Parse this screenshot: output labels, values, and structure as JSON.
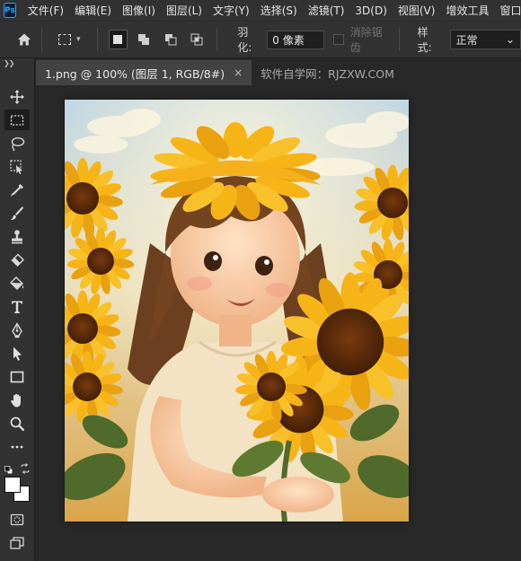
{
  "app": {
    "logo_text": "Ps"
  },
  "menu": [
    "文件(F)",
    "编辑(E)",
    "图像(I)",
    "图层(L)",
    "文字(Y)",
    "选择(S)",
    "滤镜(T)",
    "3D(D)",
    "视图(V)",
    "增效工具",
    "窗口(W)"
  ],
  "options": {
    "feather_label": "羽化:",
    "feather_value": "0 像素",
    "antialias_label": "消除锯齿",
    "style_label": "样式:",
    "style_value": "正常"
  },
  "tabs": [
    {
      "label": "1.png @ 100% (图层 1, RGB/8#)",
      "close": "×",
      "active": true
    },
    {
      "label": "软件自学网：RJZXW.COM",
      "active": false
    }
  ],
  "tools": [
    "move-tool",
    "rectangular-marquee-tool",
    "lasso-tool",
    "object-selection-tool",
    "eyedropper-tool",
    "brush-tool",
    "clone-stamp-tool",
    "eraser-tool",
    "paint-bucket-tool",
    "type-tool",
    "pen-tool",
    "path-selection-tool",
    "rectangle-tool",
    "hand-tool",
    "zoom-tool",
    "more-tools"
  ],
  "colors": {
    "accent": "#31a8ff",
    "foreground": "#ffffff",
    "background": "#ffffff"
  },
  "canvas": {
    "image_description_icon": "sunflower-girl-illustration"
  }
}
